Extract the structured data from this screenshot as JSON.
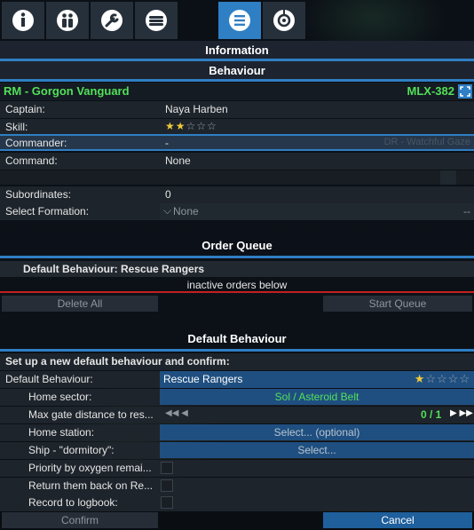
{
  "toolbar": {
    "buttons": [
      {
        "name": "info-tab-button",
        "icon": "info-icon",
        "active": false
      },
      {
        "name": "crew-tab-button",
        "icon": "crew-icon",
        "active": false
      },
      {
        "name": "repair-tab-button",
        "icon": "wrench-icon",
        "active": false
      },
      {
        "name": "loadout-tab-button",
        "icon": "ammo-icon",
        "active": false
      },
      {
        "name": "behaviour-tab-button",
        "icon": "list-icon",
        "active": true
      },
      {
        "name": "logbook-tab-button",
        "icon": "target-icon",
        "active": false
      }
    ]
  },
  "headers": {
    "information": "Information",
    "behaviour": "Behaviour"
  },
  "ship": {
    "name": "RM - Gorgon Vanguard",
    "id": "MLX-382"
  },
  "fields": {
    "captain_label": "Captain:",
    "captain_value": "Naya Harben",
    "skill_label": "Skill:",
    "skill_stars_filled": 2,
    "skill_stars_total": 5,
    "commander_label": "Commander:",
    "commander_value": "-",
    "command_label": "Command:",
    "command_value": "None",
    "subordinates_label": "Subordinates:",
    "subordinates_value": "0",
    "formation_label": "Select Formation:",
    "formation_value": "None",
    "formation_dash": "--"
  },
  "background_text": "DR - Watchful Gaze",
  "order_queue": {
    "title": "Order Queue",
    "default_line": "Default Behaviour: Rescue Rangers",
    "inactive": "inactive orders below",
    "delete_all": "Delete All",
    "start_queue": "Start Queue"
  },
  "default_behaviour": {
    "title": "Default Behaviour",
    "setup": "Set up a new default behaviour and confirm:",
    "behaviour_label": "Default Behaviour:",
    "behaviour_value": "Rescue Rangers",
    "behaviour_stars_filled": 1,
    "home_sector_label": "Home sector:",
    "home_sector_value": "Sol / Asteroid Belt",
    "max_gate_label": "Max gate distance to res...",
    "max_gate_value": "0 / 1",
    "home_station_label": "Home station:",
    "home_station_value": "Select... (optional)",
    "dormitory_label": "Ship - \"dormitory\":",
    "dormitory_value": "Select...",
    "priority_label": "Priority by oxygen remai...",
    "return_label": "Return them back on Re...",
    "record_label": "Record to logbook:",
    "confirm": "Confirm",
    "cancel": "Cancel"
  },
  "colors": {
    "accent": "#2f7fc4",
    "ship_green": "#52e05a",
    "warning_red": "#c41f1f",
    "star": "#f0c93a"
  }
}
